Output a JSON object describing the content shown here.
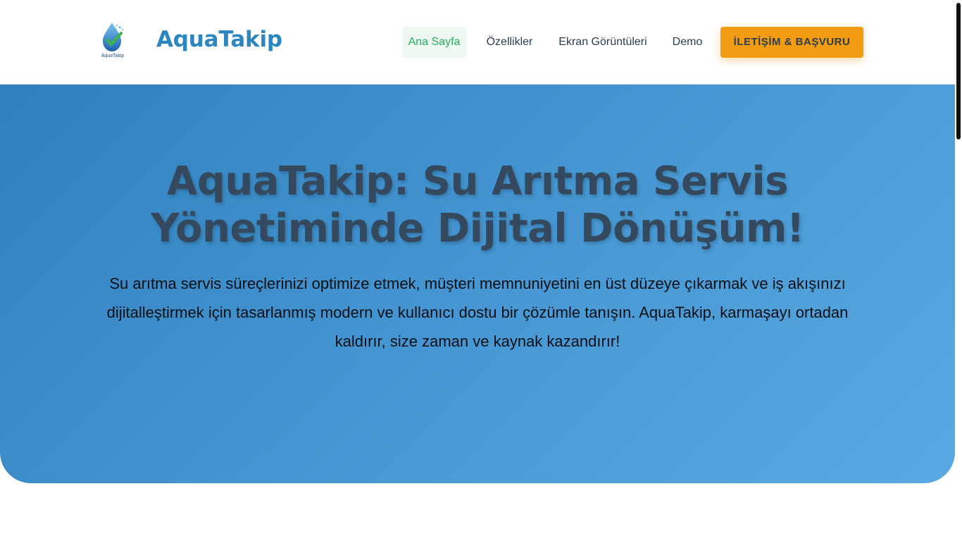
{
  "header": {
    "brand": "AquaTakip",
    "logo_caption": "AquaTakip",
    "nav": [
      {
        "label": "Ana Sayfa",
        "active": true
      },
      {
        "label": "Özellikler",
        "active": false
      },
      {
        "label": "Ekran Görüntüleri",
        "active": false
      },
      {
        "label": "Demo",
        "active": false
      }
    ],
    "cta_label": "İLETİŞİM & BAŞVURU"
  },
  "hero": {
    "title": "AquaTakip: Su Arıtma Servis Yönetiminde Dijital Dönüşüm!",
    "text": "Su arıtma servis süreçlerinizi optimize etmek, müşteri memnuniyetini en üst düzeye çıkarmak ve iş akışınızı dijitalleştirmek için tasarlanmış modern ve kullanıcı dostu bir çözümle tanışın. AquaTakip, karmaşayı ortadan kaldırır, size zaman ve kaynak kazandırır!"
  },
  "colors": {
    "brand": "#2e86c1",
    "active_nav": "#27ae60",
    "cta": "#f39c12",
    "hero_start": "#2f80bd",
    "hero_end": "#5aa9e2",
    "title": "#34495e"
  },
  "icons": {
    "logo": "water-drop-check-icon"
  }
}
